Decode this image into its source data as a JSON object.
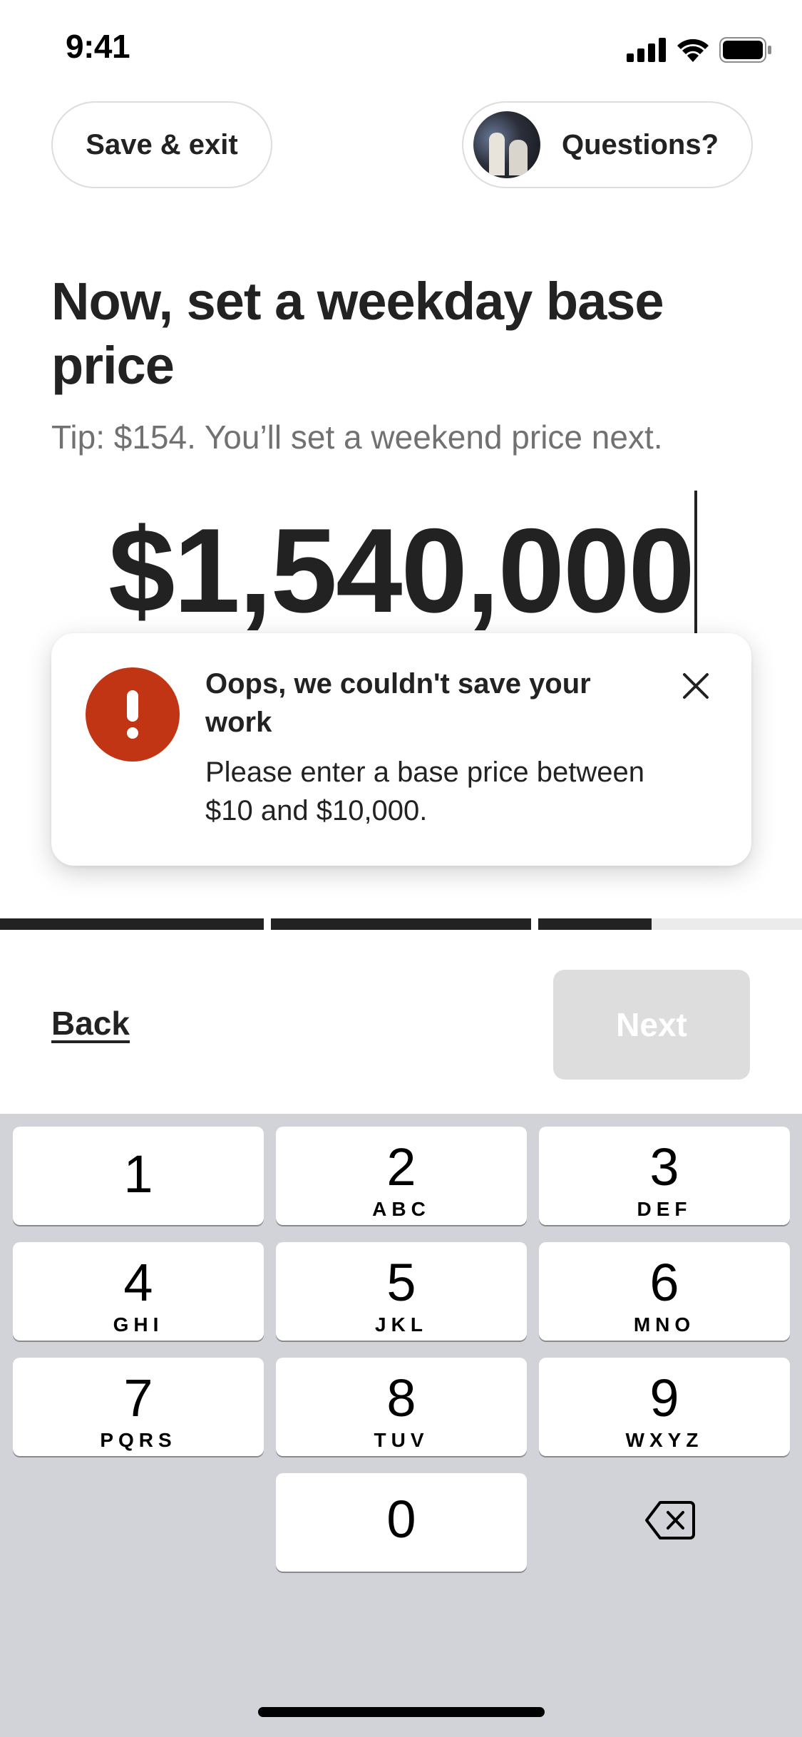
{
  "status_bar": {
    "time": "9:41"
  },
  "header": {
    "save_exit_label": "Save & exit",
    "questions_label": "Questions?"
  },
  "main": {
    "title": "Now, set a weekday base price",
    "tip": "Tip: $154. You’ll set a weekend price next.",
    "price": "$1,540,000"
  },
  "error_toast": {
    "title": "Oops, we couldn't save your work",
    "message": "Please enter a base price between $10 and $10,000."
  },
  "progress": {
    "segments_fill": [
      1,
      1,
      0.43
    ]
  },
  "footer": {
    "back_label": "Back",
    "next_label": "Next",
    "next_enabled": false
  },
  "keypad": {
    "keys": [
      {
        "digit": "1",
        "letters": ""
      },
      {
        "digit": "2",
        "letters": "ABC"
      },
      {
        "digit": "3",
        "letters": "DEF"
      },
      {
        "digit": "4",
        "letters": "GHI"
      },
      {
        "digit": "5",
        "letters": "JKL"
      },
      {
        "digit": "6",
        "letters": "MNO"
      },
      {
        "digit": "7",
        "letters": "PQRS"
      },
      {
        "digit": "8",
        "letters": "TUV"
      },
      {
        "digit": "9",
        "letters": "WXYZ"
      },
      {
        "digit": "0",
        "letters": ""
      }
    ]
  },
  "colors": {
    "error_red": "#c13515",
    "text_primary": "#222222",
    "text_secondary": "#717171",
    "disabled_button": "#dddddd",
    "keypad_background": "#d1d3d9"
  }
}
